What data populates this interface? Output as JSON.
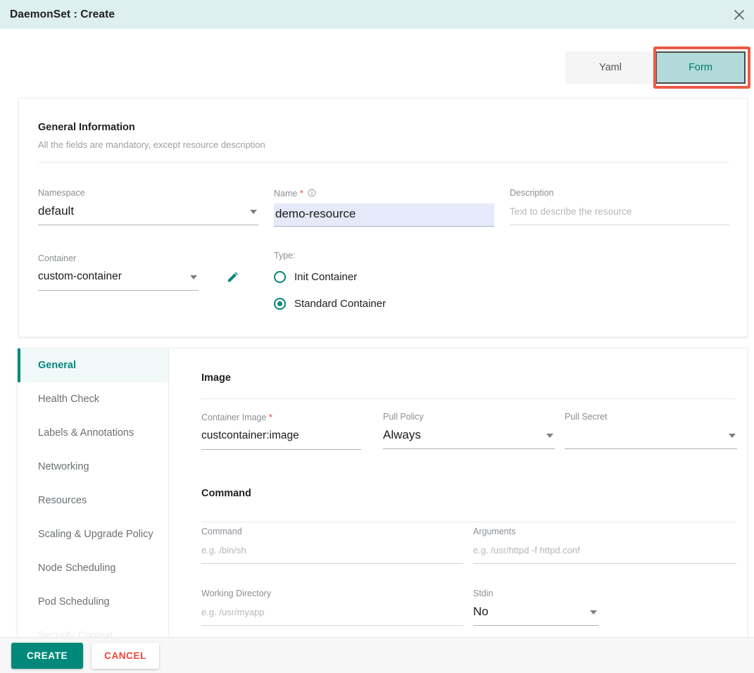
{
  "window": {
    "title": "DaemonSet : Create",
    "close_icon": "close-icon",
    "header_bg": "#ddefee"
  },
  "tabs": {
    "items": [
      {
        "label": "Yaml",
        "active": false
      },
      {
        "label": "Form",
        "active": true
      }
    ],
    "active_bg": "#b2dadb",
    "active_color": "#00796b",
    "highlight_color": "#ec5b46"
  },
  "general_information": {
    "title": "General Information",
    "subtitle": "All the fields are mandatory, except resource description",
    "namespace": {
      "label": "Namespace",
      "value": "default"
    },
    "name": {
      "label": "Name",
      "required": "*",
      "value": "demo-resource",
      "info_icon": "info-icon"
    },
    "description": {
      "label": "Description",
      "placeholder": "Text to describe the resource",
      "value": ""
    },
    "container": {
      "label": "Container",
      "value": "custom-container"
    },
    "edit_icon": "pencil-icon",
    "type": {
      "label": "Type:",
      "options": [
        {
          "label": "Init Container",
          "selected": false
        },
        {
          "label": "Standard Container",
          "selected": true
        }
      ]
    }
  },
  "sidenav": {
    "items": [
      {
        "label": "General",
        "active": true
      },
      {
        "label": "Health Check",
        "active": false
      },
      {
        "label": "Labels & Annotations",
        "active": false
      },
      {
        "label": "Networking",
        "active": false
      },
      {
        "label": "Resources",
        "active": false
      },
      {
        "label": "Scaling & Upgrade Policy",
        "active": false
      },
      {
        "label": "Node Scheduling",
        "active": false
      },
      {
        "label": "Pod Scheduling",
        "active": false
      },
      {
        "label": "Security Context",
        "active": false
      }
    ]
  },
  "form_panel": {
    "image_section": {
      "title": "Image",
      "container_image": {
        "label": "Container Image",
        "required": "*",
        "value": "custcontainer:image"
      },
      "pull_policy": {
        "label": "Pull Policy",
        "value": "Always"
      },
      "pull_secret": {
        "label": "Pull Secret",
        "value": ""
      }
    },
    "command_section": {
      "title": "Command",
      "command": {
        "label": "Command",
        "placeholder": "e.g. /bin/sh",
        "value": ""
      },
      "arguments": {
        "label": "Arguments",
        "placeholder": "e.g. /usr/httpd -f httpd.conf",
        "value": ""
      },
      "working_directory": {
        "label": "Working Directory",
        "placeholder": "e.g. /usr/myapp",
        "value": ""
      },
      "stdin": {
        "label": "Stdin",
        "value": "No"
      }
    }
  },
  "actions": {
    "create_label": "CREATE",
    "cancel_label": "CANCEL",
    "create_color": "#00897b",
    "cancel_color": "#f44336"
  }
}
